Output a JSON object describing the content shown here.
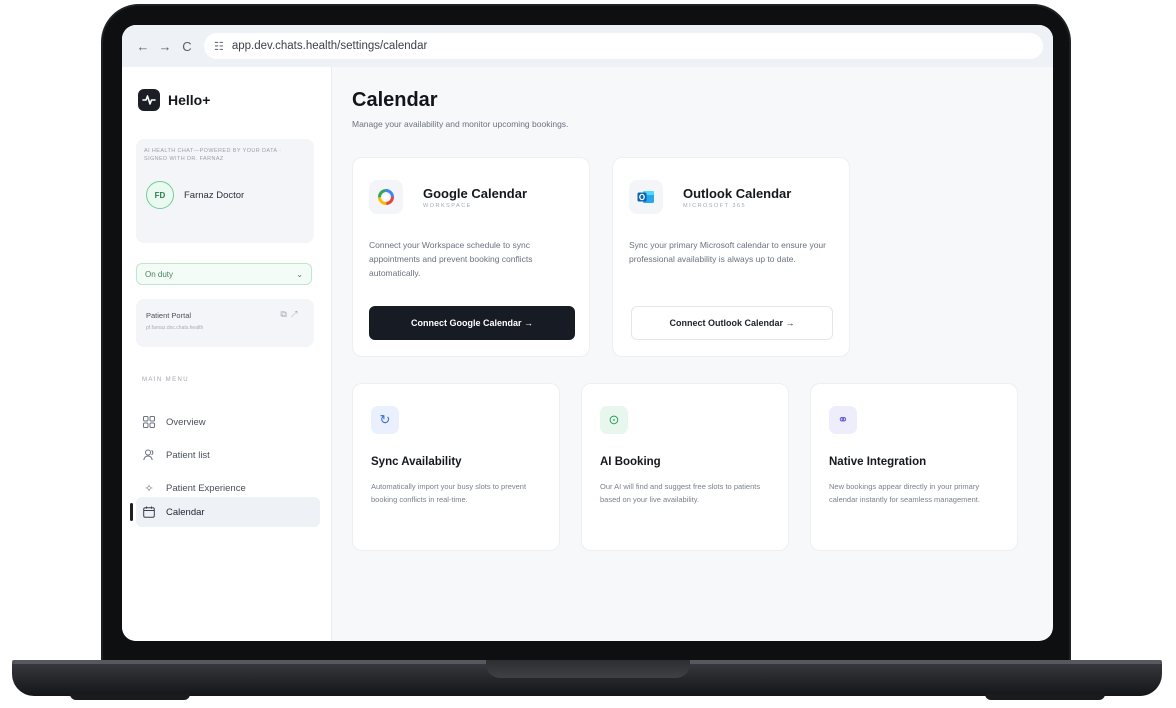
{
  "browser": {
    "url": "app.dev.chats.health/settings/calendar",
    "back_icon": "←",
    "forward_icon": "→",
    "reload_icon": "C",
    "tune_icon": "☷"
  },
  "sidebar": {
    "brand_name": "Hello+",
    "tagline": "AI HEALTH CHAT—POWERED BY YOUR DATA · SIGNED WITH DR. FARNAZ",
    "profile": {
      "initials": "FD",
      "name": "Farnaz Doctor"
    },
    "duty_status": "On duty",
    "duty_chevron": "⌄",
    "portal": {
      "title": "Patient Portal",
      "url": "pf.farnaz.doc.chats.health"
    },
    "menu_heading": "MAIN MENU",
    "menu": [
      {
        "label": "Overview",
        "icon": "grid-icon"
      },
      {
        "label": "Patient list",
        "icon": "users-icon"
      },
      {
        "label": "Patient Experience",
        "icon": "sparkle-icon"
      },
      {
        "label": "Calendar",
        "icon": "calendar-icon",
        "active": true
      }
    ]
  },
  "main": {
    "title": "Calendar",
    "subtitle": "Manage your availability and monitor upcoming bookings.",
    "providers": [
      {
        "title": "Google Calendar",
        "kicker": "WORKSPACE",
        "description": "Connect your Workspace schedule to sync appointments and prevent booking conflicts automatically.",
        "button": "Connect Google Calendar →"
      },
      {
        "title": "Outlook Calendar",
        "kicker": "MICROSOFT 365",
        "description": "Sync your primary Microsoft calendar to ensure your professional availability is always up to date.",
        "button": "Connect Outlook Calendar →"
      }
    ],
    "features": [
      {
        "title": "Sync Availability",
        "description": "Automatically import your busy slots to prevent booking conflicts in real-time.",
        "icon_glyph": "↻",
        "icon_color": "#3b6fe0",
        "icon_bg": "#eaf0fd"
      },
      {
        "title": "AI Booking",
        "description": "Our AI will find and suggest free slots to patients based on your live availability.",
        "icon_glyph": "⊙",
        "icon_color": "#2e9a5c",
        "icon_bg": "#e8f7ee"
      },
      {
        "title": "Native Integration",
        "description": "New bookings appear directly in your primary calendar instantly for seamless management.",
        "icon_glyph": "⚭",
        "icon_color": "#5a55d6",
        "icon_bg": "#eeedfc"
      }
    ]
  },
  "colors": {
    "brand_dark": "#171b24",
    "on_duty_green": "#6fcf97"
  }
}
